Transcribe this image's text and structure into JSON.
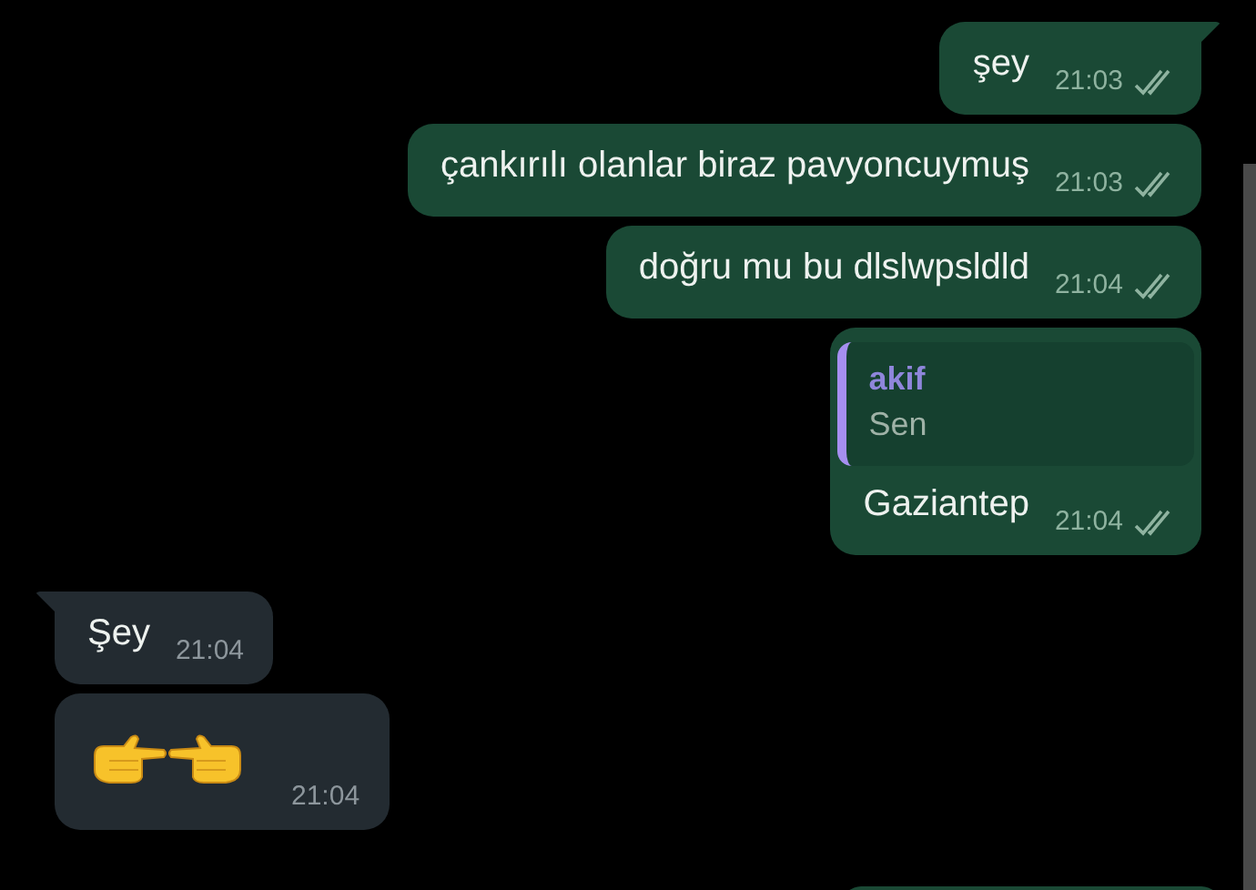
{
  "messages": [
    {
      "outgoing": true,
      "kind": "text",
      "text": "şey",
      "time": "21:03",
      "read": false,
      "tail": true
    },
    {
      "outgoing": true,
      "kind": "text",
      "text": "çankırılı olanlar biraz pavyoncuymuş",
      "time": "21:03",
      "read": false,
      "tail": false
    },
    {
      "outgoing": true,
      "kind": "text",
      "text": "doğru mu bu dlslwpsldld",
      "time": "21:04",
      "read": false,
      "tail": false
    },
    {
      "outgoing": true,
      "kind": "reply",
      "quote": {
        "author": "akif",
        "text": "Sen"
      },
      "text": "Gaziantep",
      "time": "21:04",
      "read": false,
      "tail": false
    },
    {
      "outgoing": false,
      "kind": "text",
      "text": "Şey",
      "time": "21:04",
      "tail": true
    },
    {
      "outgoing": false,
      "kind": "hands",
      "time": "21:04",
      "tail": false
    }
  ]
}
